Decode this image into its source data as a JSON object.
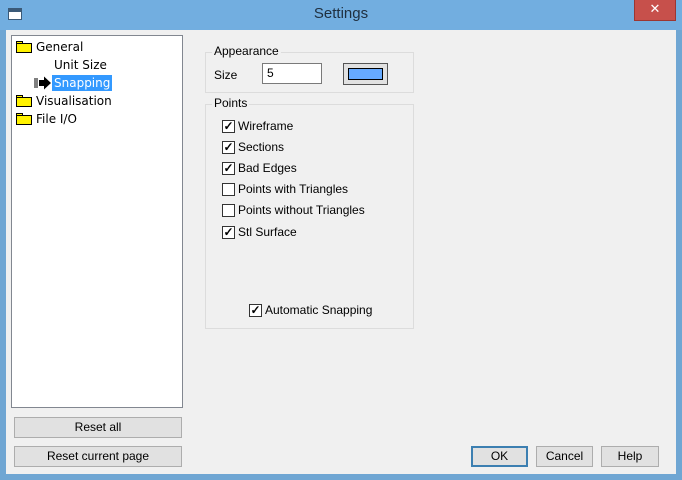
{
  "window": {
    "title": "Settings",
    "close_glyph": "✕"
  },
  "tree": {
    "items": [
      {
        "label": "General"
      },
      {
        "label": "Unit Size"
      },
      {
        "label": "Snapping"
      },
      {
        "label": "Visualisation"
      },
      {
        "label": "File I/O"
      }
    ],
    "selected": "Snapping"
  },
  "left_buttons": {
    "reset_all": "Reset all",
    "reset_page": "Reset current page"
  },
  "appearance": {
    "group_title": "Appearance",
    "size_label": "Size",
    "size_value": "5",
    "color": "#66aaff"
  },
  "points": {
    "group_title": "Points",
    "checkboxes": [
      {
        "label": "Wireframe",
        "checked": true
      },
      {
        "label": "Sections",
        "checked": true
      },
      {
        "label": "Bad Edges",
        "checked": true
      },
      {
        "label": "Points with Triangles",
        "checked": false
      },
      {
        "label": "Points without Triangles",
        "checked": false
      },
      {
        "label": "Stl Surface",
        "checked": true
      }
    ],
    "auto_snapping": {
      "label": "Automatic Snapping",
      "checked": true
    }
  },
  "dialog_buttons": {
    "ok": "OK",
    "cancel": "Cancel",
    "help": "Help"
  },
  "colors": {
    "titlebar": "#72aee0",
    "close": "#c7504b",
    "selection": "#3399ff",
    "folder": "#fff200"
  }
}
